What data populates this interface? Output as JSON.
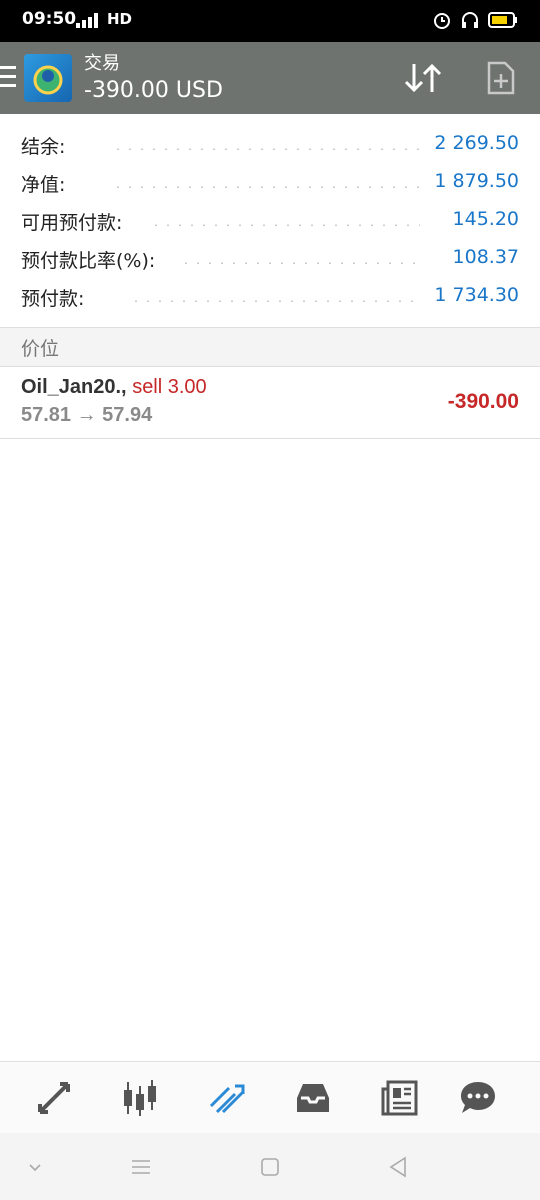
{
  "status_bar": {
    "time": "09:50",
    "network": "HD",
    "icons": [
      "signal-icon",
      "alarm-icon",
      "headphones-icon",
      "battery-icon"
    ]
  },
  "app_bar": {
    "title": "交易",
    "balance_line": "-390.00 USD",
    "icons": [
      "menu-icon",
      "app-logo",
      "sort-icon",
      "new-order-icon"
    ]
  },
  "summary": {
    "rows": [
      {
        "label": "结余:",
        "value": "2 269.50"
      },
      {
        "label": "净值:",
        "value": "1 879.50"
      },
      {
        "label": "可用预付款:",
        "value": "145.20"
      },
      {
        "label": "预付款比率(%):",
        "value": "108.37"
      },
      {
        "label": "预付款:",
        "value": "1 734.30"
      }
    ]
  },
  "positions_section": {
    "header": "价位",
    "items": [
      {
        "symbol": "Oil_Jan20.,",
        "side": "sell 3.00",
        "prices": "57.81 → 57.94",
        "profit": "-390.00"
      }
    ]
  },
  "bottom_nav": {
    "items": [
      "quotes-icon",
      "chart-icon",
      "trade-icon",
      "history-icon",
      "news-icon",
      "chat-icon"
    ],
    "active": "trade-icon"
  },
  "colors": {
    "accent": "#1976c8",
    "loss": "#c62828",
    "app_bar": "#6e736f"
  }
}
